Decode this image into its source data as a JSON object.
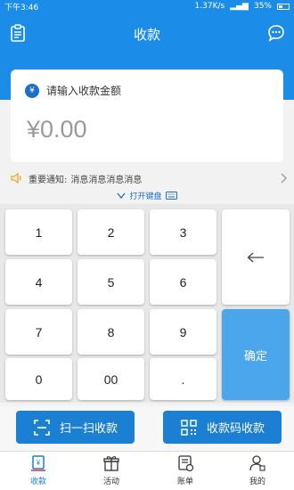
{
  "status_bar": {
    "time": "下午3:46",
    "speed": "1.37K/s",
    "battery": "35%"
  },
  "header": {
    "title": "收款"
  },
  "amount": {
    "currency_symbol": "¥",
    "prompt": "请输入收款金额",
    "value": "¥0.00"
  },
  "notice": {
    "label": "重要通知:",
    "message": "消息消息消息消息"
  },
  "keyboard_toggle": {
    "label": "打开键盘"
  },
  "keypad": {
    "keys": [
      "1",
      "2",
      "3",
      "4",
      "5",
      "6",
      "7",
      "8",
      "9",
      "0",
      "00",
      "."
    ],
    "confirm": "确定"
  },
  "actions": {
    "scan_label": "扫一扫收款",
    "qr_label": "收款码收款"
  },
  "tabs": [
    {
      "label": "收款",
      "icon": "receive-icon"
    },
    {
      "label": "活动",
      "icon": "gift-icon"
    },
    {
      "label": "账单",
      "icon": "bill-icon"
    },
    {
      "label": "我的",
      "icon": "user-icon"
    }
  ],
  "colors": {
    "primary": "#1b8de8",
    "button": "#1b7fd4",
    "confirm": "#4ca6ec"
  }
}
